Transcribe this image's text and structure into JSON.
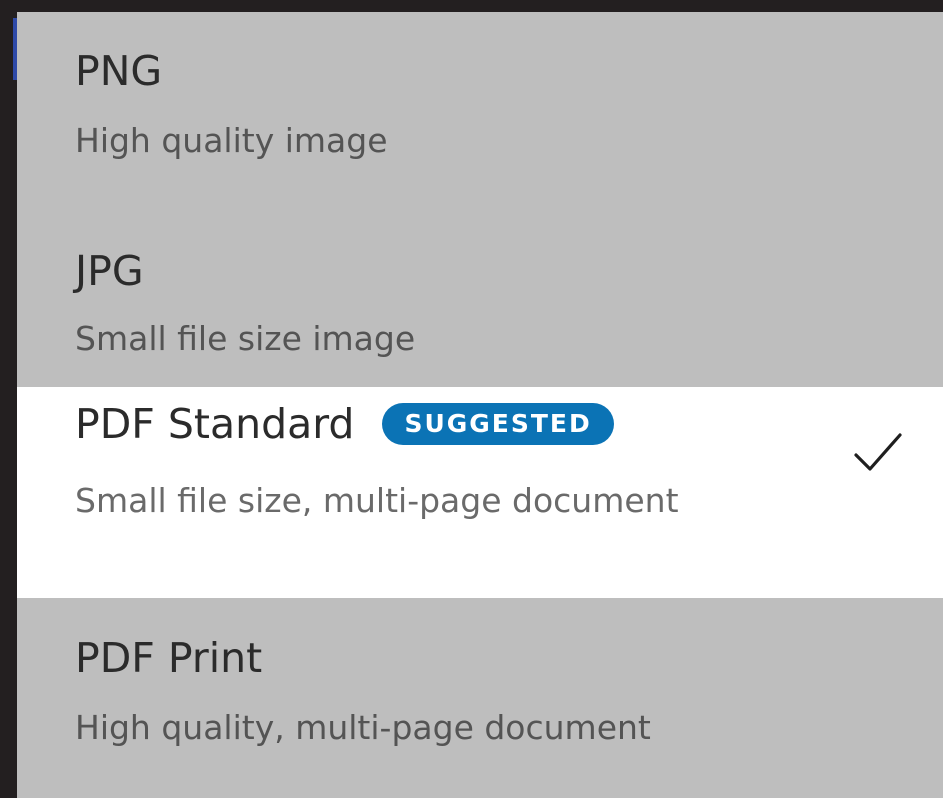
{
  "options": [
    {
      "title": "PNG",
      "subtitle": "High quality image",
      "selected": false
    },
    {
      "title": "JPG",
      "subtitle": "Small file size image",
      "selected": false
    },
    {
      "title": "PDF Standard",
      "subtitle": "Small file size, multi-page document",
      "badge": "SUGGESTED",
      "selected": true,
      "check_icon": "checkmark-icon"
    },
    {
      "title": "PDF Print",
      "subtitle": "High quality, multi-page document",
      "selected": false
    }
  ],
  "colors": {
    "background": "#231f20",
    "menu": "#bebebe",
    "selected": "#ffffff",
    "badge": "#0b73b5"
  }
}
